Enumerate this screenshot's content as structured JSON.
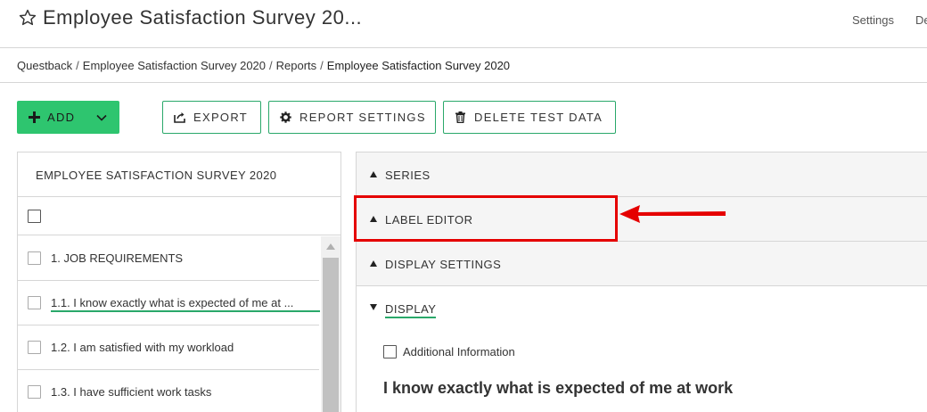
{
  "header": {
    "title": "Employee Satisfaction Survey 20...",
    "links": [
      "Settings",
      "De"
    ]
  },
  "breadcrumb": {
    "items": [
      "Questback",
      "Employee Satisfaction Survey 2020",
      "Reports"
    ],
    "current": "Employee Satisfaction Survey 2020",
    "separator": "/"
  },
  "toolbar": {
    "add_label": "ADD",
    "export_label": "EXPORT",
    "report_settings_label": "REPORT SETTINGS",
    "delete_test_data_label": "DELETE TEST DATA"
  },
  "left_panel": {
    "title": "EMPLOYEE SATISFACTION SURVEY 2020",
    "items": [
      {
        "label": "1.  JOB REQUIREMENTS"
      },
      {
        "label": "1.1.  I know exactly what is expected of me at ..."
      },
      {
        "label": "1.2.  I am satisfied with my workload"
      },
      {
        "label": "1.3.  I have sufficient work tasks"
      }
    ]
  },
  "right_panel": {
    "sections": [
      {
        "label": "SERIES"
      },
      {
        "label": "LABEL EDITOR"
      },
      {
        "label": "DISPLAY SETTINGS"
      }
    ],
    "display": {
      "label": "DISPLAY",
      "additional_info_label": "Additional Information",
      "question_title": "I know exactly what is expected of me at work"
    }
  },
  "colors": {
    "accent_green": "#2ec56f",
    "annotation_red": "#e50000"
  }
}
